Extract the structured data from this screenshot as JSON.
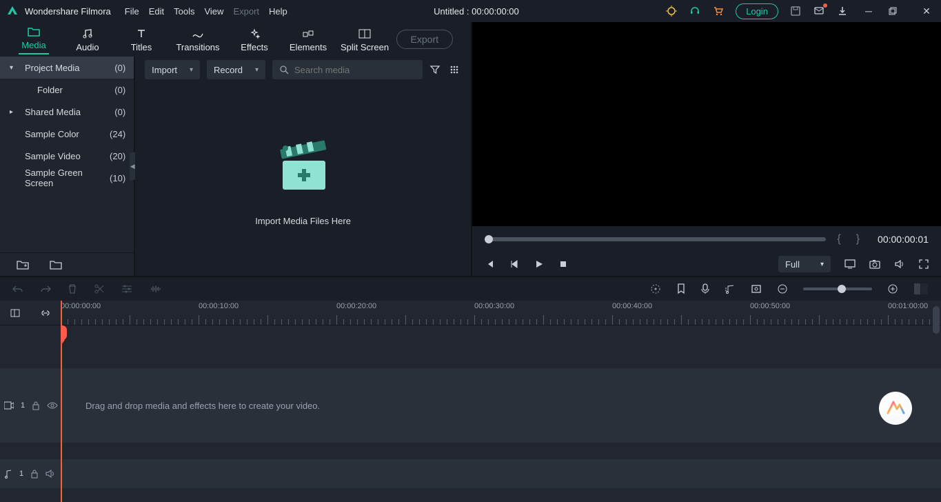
{
  "app": {
    "name": "Wondershare Filmora"
  },
  "menu": [
    "File",
    "Edit",
    "Tools",
    "View",
    "Export",
    "Help"
  ],
  "menu_disabled_index": 4,
  "title_center": "Untitled : 00:00:00:00",
  "login_label": "Login",
  "tabs": [
    {
      "label": "Media"
    },
    {
      "label": "Audio"
    },
    {
      "label": "Titles"
    },
    {
      "label": "Transitions"
    },
    {
      "label": "Effects"
    },
    {
      "label": "Elements"
    },
    {
      "label": "Split Screen"
    }
  ],
  "export_label": "Export",
  "sidebar": [
    {
      "label": "Project Media",
      "count": "(0)",
      "chev": "▾",
      "active": true,
      "indent": 0
    },
    {
      "label": "Folder",
      "count": "(0)",
      "chev": "",
      "indent": 1
    },
    {
      "label": "Shared Media",
      "count": "(0)",
      "chev": "▸",
      "indent": 0
    },
    {
      "label": "Sample Color",
      "count": "(24)",
      "chev": "",
      "indent": 0
    },
    {
      "label": "Sample Video",
      "count": "(20)",
      "chev": "",
      "indent": 0
    },
    {
      "label": "Sample Green Screen",
      "count": "(10)",
      "chev": "",
      "indent": 0
    }
  ],
  "toolbar": {
    "import_label": "Import",
    "record_label": "Record",
    "search_placeholder": "Search media"
  },
  "empty_media_text": "Import Media Files Here",
  "preview": {
    "time": "00:00:00:01",
    "quality": "Full"
  },
  "timeline": {
    "majors": [
      "00:00:00:00",
      "00:00:10:00",
      "00:00:20:00",
      "00:00:30:00",
      "00:00:40:00",
      "00:00:50:00",
      "00:01:00:00"
    ],
    "drop_msg": "Drag and drop media and effects here to create your video."
  },
  "track_v_label": "1",
  "track_a_label": "1"
}
